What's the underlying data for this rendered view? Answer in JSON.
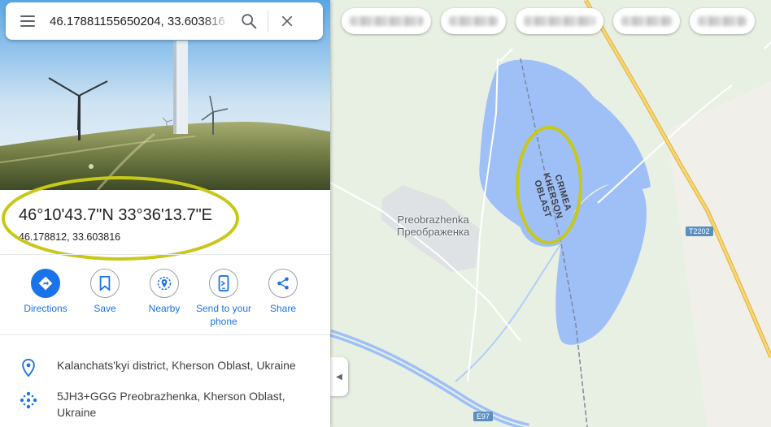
{
  "search": {
    "query": "46.17881155650204, 33.603816"
  },
  "place": {
    "coordinates_dms": "46°10'43.7\"N 33°36'13.7\"E",
    "coordinates_decimal": "46.178812, 33.603816"
  },
  "actions": [
    {
      "label": "Directions",
      "icon": "directions-icon"
    },
    {
      "label": "Save",
      "icon": "bookmark-icon"
    },
    {
      "label": "Nearby",
      "icon": "nearby-icon"
    },
    {
      "label": "Send to your phone",
      "icon": "phone-icon"
    },
    {
      "label": "Share",
      "icon": "share-icon"
    }
  ],
  "details": {
    "district": "Kalanchats'kyi district, Kherson Oblast, Ukraine",
    "plus_code": "5JH3+GGG Preobrazhenka, Kherson Oblast, Ukraine"
  },
  "map": {
    "settlement_latin": "Preobrazhenka",
    "settlement_cyrillic": "Преображенка",
    "border_label_line1": "CRIMEA",
    "border_label_line2": "KHERSON OBLAST",
    "road_t2202": "T2202",
    "road_e97": "E97"
  },
  "colors": {
    "accent_blue": "#1a73e8",
    "water": "#9fbff7",
    "highlight_ellipse": "#c8c81a",
    "pin_red": "#ea4335",
    "road_yellow": "#f7c948"
  }
}
